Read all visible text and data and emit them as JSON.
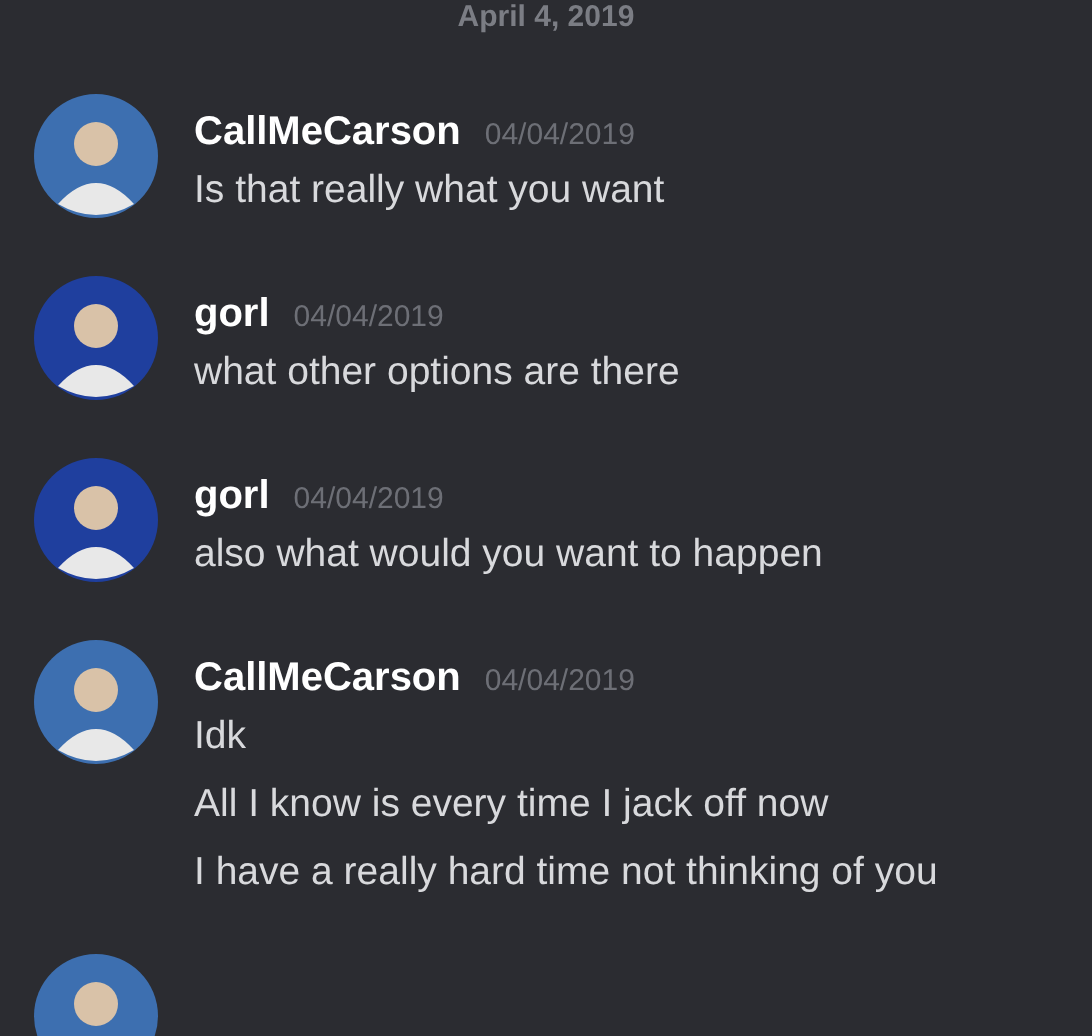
{
  "date_divider": "April 4, 2019",
  "messages": [
    {
      "color": "#3d6fb0",
      "username": "CallMeCarson",
      "timestamp": "04/04/2019",
      "lines": [
        "Is that really what you want"
      ]
    },
    {
      "color": "#1f3f9e",
      "username": "gorl",
      "timestamp": "04/04/2019",
      "lines": [
        "what other options are there"
      ]
    },
    {
      "color": "#1f3f9e",
      "username": "gorl",
      "timestamp": "04/04/2019",
      "lines": [
        "also what would you want to happen"
      ]
    },
    {
      "color": "#3d6fb0",
      "username": "CallMeCarson",
      "timestamp": "04/04/2019",
      "lines": [
        "Idk",
        "All I know is every time I jack off now",
        "I have a really hard time not thinking of you"
      ]
    },
    {
      "color": "#3d6fb0"
    }
  ]
}
